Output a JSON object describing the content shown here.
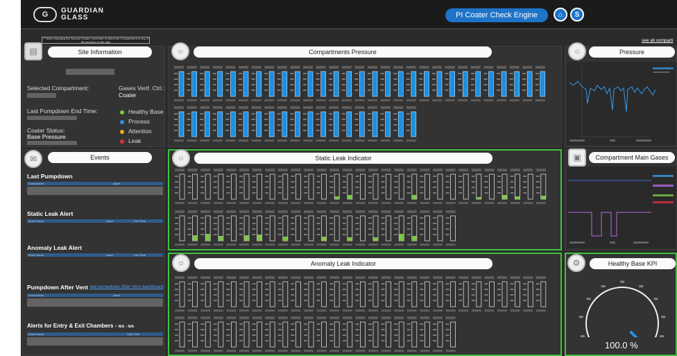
{
  "header": {
    "logo_mark": "G",
    "logo_line1": "GUARDIAN",
    "logo_line2": "GLASS",
    "engine_button": "PI Coater Check Engine",
    "home_icon": "home-icon",
    "sp_icon_label": "S"
  },
  "note": {
    "text": "** When changing the Vacuum Coater, remember to select the Compartment in any of the sections on the right"
  },
  "site": {
    "title": "Site Information",
    "selected_label": "Selected Compartment:",
    "gases_label": "Gases Verif. Ctrl.:",
    "gases_value": "Coater",
    "pumpdown_label": "Last Pumpdown End Time:",
    "status_label": "Coater Status:",
    "status_value": "Base Pressure",
    "legend": [
      {
        "label": "Healthy Base",
        "color": "#7ac943"
      },
      {
        "label": "Process",
        "color": "#2e8fe0"
      },
      {
        "label": "Attention",
        "color": "#f7a81b"
      },
      {
        "label": "Leak",
        "color": "#e0303a"
      }
    ]
  },
  "events": {
    "title": "Events",
    "last_pumpdown": "Last Pumpdown",
    "static_alert": "Static Leak Alert",
    "anomaly_alert": "Anomaly Leak Alert",
    "pumpdown_after_vent": "Pumpdown After Vent",
    "pumpdown_link": "see pumpdown After Vent dashboard",
    "entry_exit": "Alerts for Entry & Exit Chambers -",
    "entry_exit_na1": "N/A",
    "entry_exit_na2": "- N/A",
    "col_event_name": "Event Name",
    "col_asset": "Asset",
    "col_end_time": "End Time",
    "col_start_time": "Start Time"
  },
  "compartments": {
    "title": "Compartments Pressure"
  },
  "static_leak": {
    "title": "Static Leak Indicator"
  },
  "anomaly_leak": {
    "title": "Anomaly Leak Indicator"
  },
  "pressure": {
    "title": "Pressure",
    "see_all": "see all comparti"
  },
  "gases": {
    "title": "Compartment Main Gases"
  },
  "kpi": {
    "title": "Healthy Base KPI",
    "value": "100.0 %",
    "fraction": 1.0
  },
  "colors": {
    "blue": "#1e8fe0",
    "green": "#7ac943",
    "panel_border_active": "#3ec33e"
  }
}
